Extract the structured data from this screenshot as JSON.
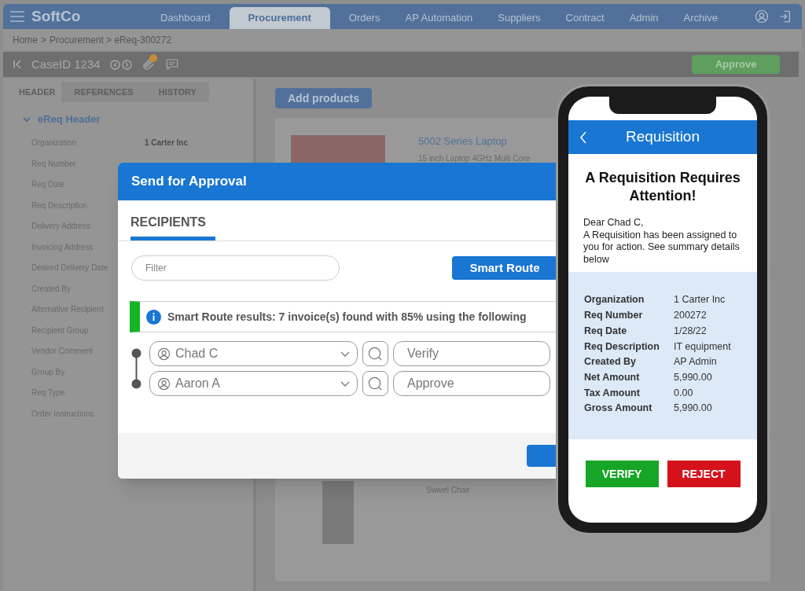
{
  "nav": {
    "logo": "SoftCo",
    "tabs": [
      {
        "label": "Dashboard",
        "selected": false
      },
      {
        "label": "Procurement",
        "selected": true
      },
      {
        "label": "Orders",
        "selected": false
      },
      {
        "label": "AP Automation",
        "selected": false
      },
      {
        "label": "Suppliers",
        "selected": false
      },
      {
        "label": "Contract",
        "selected": false
      },
      {
        "label": "Admin",
        "selected": false
      },
      {
        "label": "Archive",
        "selected": false
      }
    ]
  },
  "breadcrumb": [
    "Home",
    ">",
    "Procurement > eReq-300272"
  ],
  "toolbar": {
    "case_id": "CaseID 1234",
    "approve": "Approve"
  },
  "panel_tabs": [
    {
      "label": "HEADER",
      "selected": true
    },
    {
      "label": "REFERENCES",
      "selected": false
    },
    {
      "label": "HISTORY",
      "selected": false
    }
  ],
  "section": {
    "title": "eReq Header",
    "expanded": true
  },
  "fields": [
    {
      "label": "Organization",
      "value": "1 Carter Inc"
    },
    {
      "label": "Req Number"
    },
    {
      "label": "Req Date"
    },
    {
      "label": "Req Description"
    },
    {
      "label": "Delivery Address"
    },
    {
      "label": "Invoicing Address"
    },
    {
      "label": "Desired Delivery Date"
    },
    {
      "label": "Created By"
    },
    {
      "label": "Alternative Recipient"
    },
    {
      "label": "Recipient Group"
    },
    {
      "label": "Vendor Comment"
    },
    {
      "label": "Group By"
    },
    {
      "label": "Req Type"
    },
    {
      "label": "Order Instructions"
    }
  ],
  "add_products": "Add products",
  "products": [
    {
      "name": "5002 Series Laptop",
      "description": "15 inch Laptop 4GHz Multi Core"
    },
    {
      "name": "Swivel Chair"
    }
  ],
  "modal": {
    "title": "Send for Approval",
    "tab": "RECIPIENTS",
    "filter_placeholder": "Filter",
    "smart_route": "Smart Route",
    "banner": "Smart Route results: 7 invoice(s) found with 85% using the following",
    "recipients": [
      {
        "name": "Chad C",
        "action": "Verify"
      },
      {
        "name": "Aaron A",
        "action": "Approve"
      }
    ]
  },
  "phone": {
    "title": "Requisition",
    "heading": "A Requisition Requires Attention!",
    "greeting": "Dear Chad C,",
    "message": "A Requisition has been assigned to you for action. See summary details below",
    "details": [
      {
        "label": "Organization",
        "value": "1 Carter Inc"
      },
      {
        "label": "Req Number",
        "value": "200272"
      },
      {
        "label": "Req Date",
        "value": "1/28/22"
      },
      {
        "label": "Req Description",
        "value": "IT equipment"
      },
      {
        "label": "Created By",
        "value": "AP Admin"
      },
      {
        "label": "Net Amount",
        "value": "5,990.00"
      },
      {
        "label": "Tax Amount",
        "value": "0.00"
      },
      {
        "label": "Gross Amount",
        "value": "5,990.00"
      }
    ],
    "verify": "VERIFY",
    "reject": "REJECT"
  }
}
